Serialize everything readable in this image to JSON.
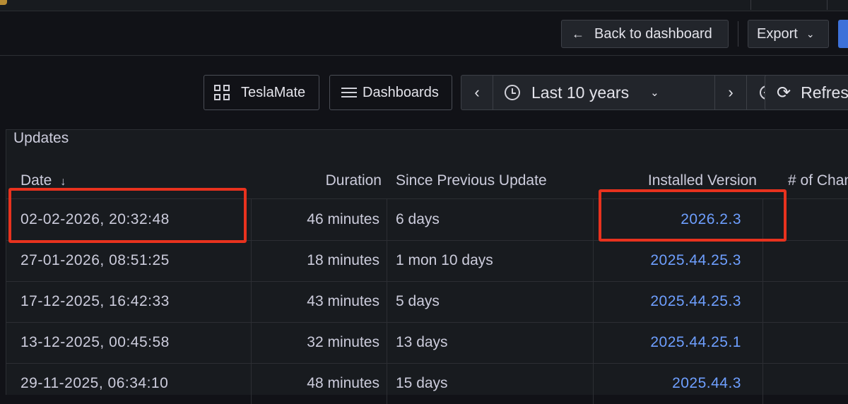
{
  "toolbar": {
    "back_label": "Back to dashboard",
    "export_label": "Export"
  },
  "nav": {
    "teslamate_label": "TeslaMate",
    "dashboards_label": "Dashboards",
    "time_range": "Last 10 years",
    "refresh_label": "Refresh"
  },
  "panel": {
    "title": "Updates",
    "columns": [
      "Date",
      "Duration",
      "Since Previous Update",
      "Installed Version",
      "# of Changes"
    ],
    "rows": [
      {
        "date": "02-02-2026, 20:32:48",
        "duration": "46 minutes",
        "since": "6 days",
        "version": "2026.2.3"
      },
      {
        "date": "27-01-2026, 08:51:25",
        "duration": "18 minutes",
        "since": "1 mon 10 days",
        "version": "2025.44.25.3"
      },
      {
        "date": "17-12-2025, 16:42:33",
        "duration": "43 minutes",
        "since": "5 days",
        "version": "2025.44.25.3"
      },
      {
        "date": "13-12-2025, 00:45:58",
        "duration": "32 minutes",
        "since": "13 days",
        "version": "2025.44.25.1"
      },
      {
        "date": "29-11-2025, 06:34:10",
        "duration": "48 minutes",
        "since": "15 days",
        "version": "2025.44.3"
      }
    ]
  },
  "colors": {
    "background": "#111217",
    "panel": "#181b1f",
    "link": "#6e9fff",
    "highlight_box": "#e8321e"
  }
}
